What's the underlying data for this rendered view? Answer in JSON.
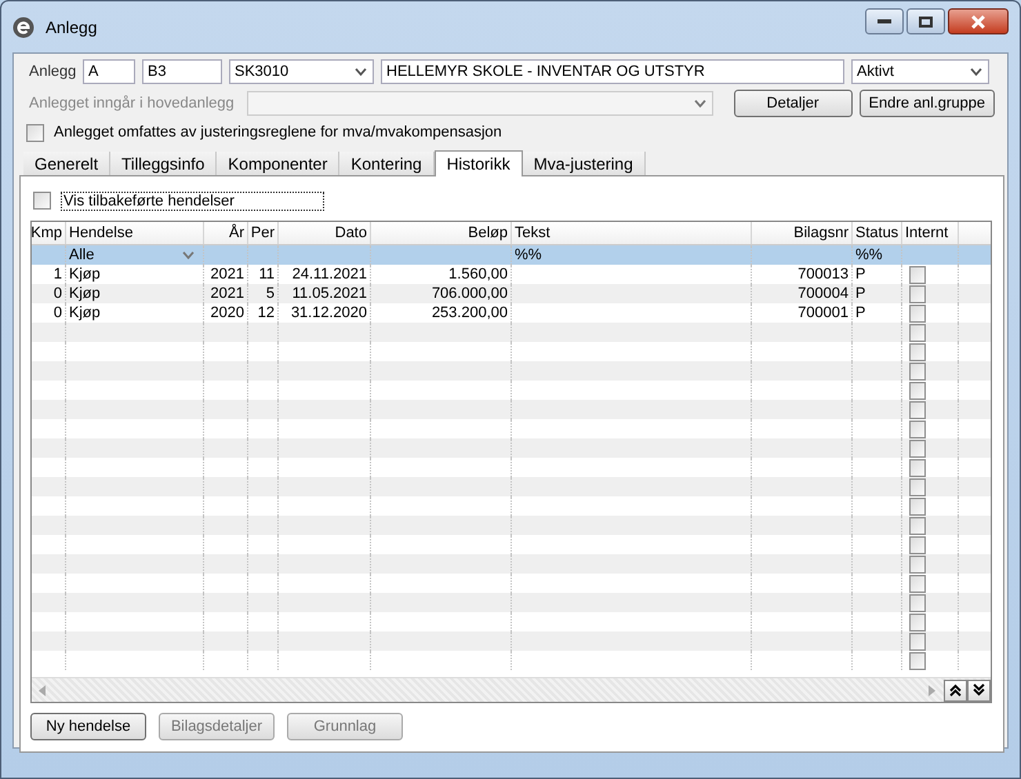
{
  "window": {
    "title": "Anlegg"
  },
  "header": {
    "label": "Anlegg",
    "group": "A",
    "code": "B3",
    "account": "SK3010",
    "name": "HELLEMYR SKOLE - INVENTAR OG UTSTYR",
    "status": "Aktivt",
    "parent_label": "Anlegget inngår i hovedanlegg",
    "parent_disabled": true,
    "buttons": [
      {
        "label": "Detaljer"
      },
      {
        "label": "Endre anl.gruppe"
      }
    ],
    "adjust": {
      "label": "Anlegget omfattes av justeringsreglene for mva/mvakompensasjon",
      "checked": false
    }
  },
  "tabs": [
    {
      "label": "Generelt",
      "selected": false
    },
    {
      "label": "Tilleggsinfo",
      "selected": false
    },
    {
      "label": "Komponenter",
      "selected": false
    },
    {
      "label": "Kontering",
      "selected": false
    },
    {
      "label": "Historikk",
      "selected": true
    },
    {
      "label": "Mva-justering",
      "selected": false
    }
  ],
  "show_reversed": {
    "label": "Vis tilbakeførte hendelser",
    "checked": false
  },
  "table": {
    "columns": [
      "Kmp",
      "Hendelse",
      "År",
      "Per",
      "Dato",
      "Beløp",
      "Tekst",
      "Bilagsnr",
      "Status",
      "Internt"
    ],
    "filter": {
      "event": "Alle",
      "text": "%%",
      "status": "%%"
    },
    "rows": [
      {
        "kmp": "1",
        "event": "Kjøp",
        "year": "2021",
        "period": "11",
        "date": "24.11.2021",
        "amount": "1.560,00",
        "text": "",
        "voucher": "700013",
        "status": "P",
        "internal": false
      },
      {
        "kmp": "0",
        "event": "Kjøp",
        "year": "2021",
        "period": "5",
        "date": "11.05.2021",
        "amount": "706.000,00",
        "text": "",
        "voucher": "700004",
        "status": "P",
        "internal": false
      },
      {
        "kmp": "0",
        "event": "Kjøp",
        "year": "2020",
        "period": "12",
        "date": "31.12.2020",
        "amount": "253.200,00",
        "text": "",
        "voucher": "700001",
        "status": "P",
        "internal": false
      }
    ],
    "empty_rows": [
      {
        "internal": false
      },
      {
        "internal": false
      },
      {
        "internal": false
      },
      {
        "internal": false
      },
      {
        "internal": false
      },
      {
        "internal": false
      },
      {
        "internal": false
      },
      {
        "internal": false
      },
      {
        "internal": false
      },
      {
        "internal": false
      },
      {
        "internal": false
      },
      {
        "internal": false
      },
      {
        "internal": false
      },
      {
        "internal": false
      },
      {
        "internal": false
      },
      {
        "internal": false
      },
      {
        "internal": false
      },
      {
        "internal": false
      }
    ]
  },
  "buttons": [
    {
      "label": "Ny hendelse",
      "disabled": false
    },
    {
      "label": "Bilagsdetaljer",
      "disabled": true
    },
    {
      "label": "Grunnlag",
      "disabled": true
    }
  ]
}
